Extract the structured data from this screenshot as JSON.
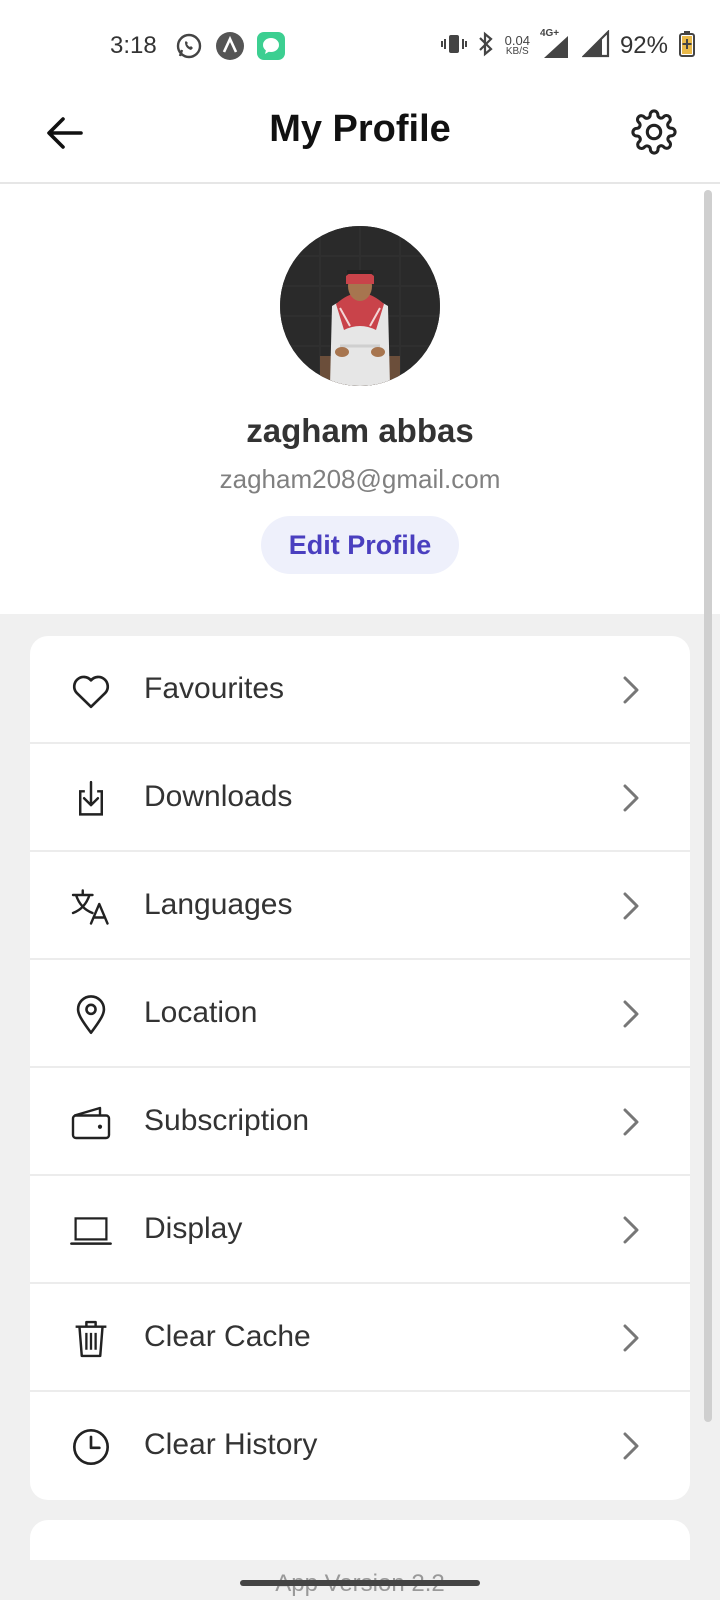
{
  "status_bar": {
    "time": "3:18",
    "network_speed_value": "0.04",
    "network_speed_unit": "KB/S",
    "network_type": "4G+",
    "battery_percent": "92%"
  },
  "header": {
    "title": "My Profile"
  },
  "profile": {
    "name": "zagham abbas",
    "email": "zagham208@gmail.com",
    "edit_label": "Edit Profile"
  },
  "menu": {
    "items": [
      {
        "label": "Favourites",
        "icon": "heart-icon"
      },
      {
        "label": "Downloads",
        "icon": "download-icon"
      },
      {
        "label": "Languages",
        "icon": "translate-icon"
      },
      {
        "label": "Location",
        "icon": "location-pin-icon"
      },
      {
        "label": "Subscription",
        "icon": "wallet-icon"
      },
      {
        "label": "Display",
        "icon": "laptop-icon"
      },
      {
        "label": "Clear Cache",
        "icon": "trash-icon"
      },
      {
        "label": "Clear History",
        "icon": "clock-icon"
      }
    ]
  },
  "footer": {
    "app_version": "App Version 2.2"
  },
  "colors": {
    "accent": "#4a3fbf",
    "accent_bg": "#eef0fb",
    "background_gray": "#f0f0f0"
  }
}
